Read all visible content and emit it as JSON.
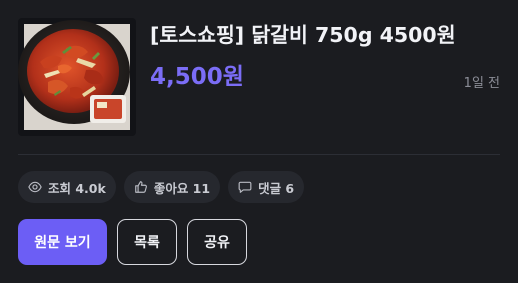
{
  "post": {
    "title": "[토스쇼핑] 닭갈비 750g 4500원",
    "price": "4,500원",
    "time": "1일 전"
  },
  "stats": {
    "views_label": "조회 4.0k",
    "likes_label": "좋아요 11",
    "comments_label": "댓글 6"
  },
  "actions": {
    "original_label": "원문 보기",
    "list_label": "목록",
    "share_label": "공유"
  },
  "colors": {
    "background": "#1b1c20",
    "accent": "#6c5ef5",
    "price": "#7b6df6",
    "chip_bg": "#26282e"
  },
  "icons": {
    "views": "eye-icon",
    "likes": "thumbs-up-icon",
    "comments": "comment-icon"
  }
}
